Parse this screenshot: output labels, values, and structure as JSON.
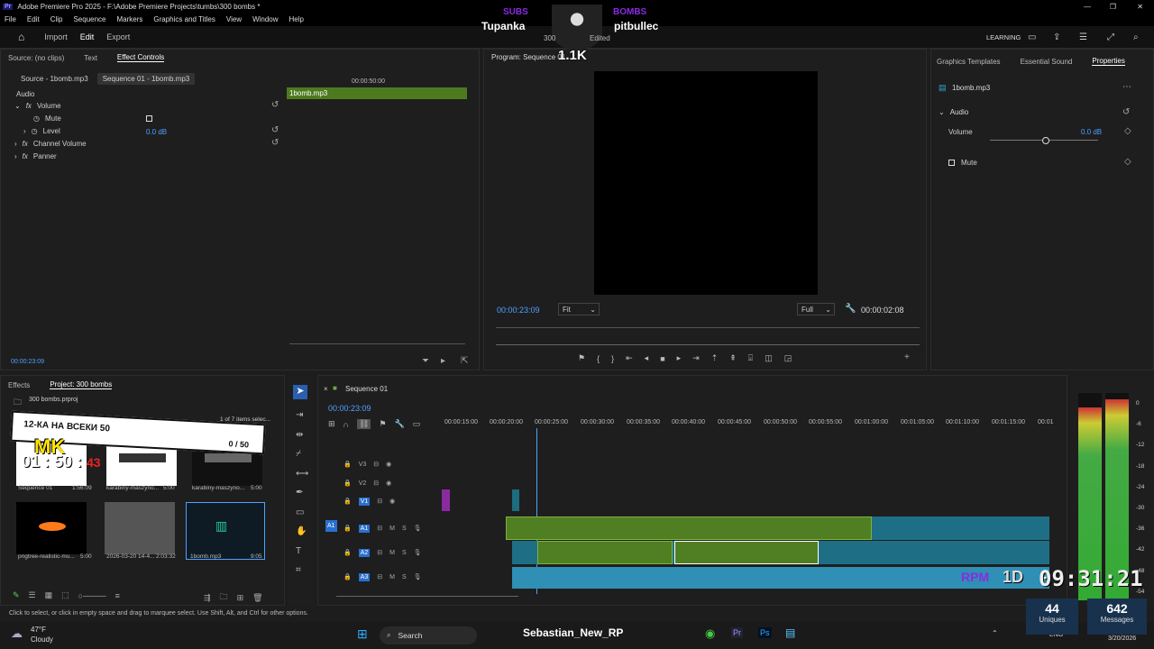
{
  "app": {
    "title": "Adobe Premiere Pro 2025 - F:\\Adobe Premiere Projects\\tumbs\\300 bombs *",
    "logo": "Pr"
  },
  "menu": [
    "File",
    "Edit",
    "Clip",
    "Sequence",
    "Markers",
    "Graphics and Titles",
    "View",
    "Window",
    "Help"
  ],
  "toolbar": {
    "import": "Import",
    "edit": "Edit",
    "export": "Export",
    "learning": "LEARNING"
  },
  "overlay": {
    "subs_label": "SUBS",
    "subs_name": "Tupanka",
    "bombs_label": "BOMBS",
    "bombs_name": "pitbullec",
    "count": "1.1K",
    "edited": "Edited",
    "num300": "300",
    "counter_title": "12-КА НА ВСЕКИ 50",
    "counter_value": "0 / 50",
    "mk": "MK",
    "timer_a": "01 : 50 :",
    "timer_b": "43",
    "rpm": "RPM",
    "days": "1D",
    "clock": "09:31:21",
    "uniques_n": "44",
    "uniques": "Uniques",
    "messages_n": "642",
    "messages": "Messages"
  },
  "source_panel": {
    "tabs": [
      "Source: (no clips)",
      "Text",
      "Effect Controls"
    ],
    "sub_tabs": [
      "Source - 1bomb.mp3",
      "Sequence 01 - 1bomb.mp3"
    ],
    "timecode_ruler": "00:00:50:00",
    "clip": "1bomb.mp3",
    "section": "Audio",
    "volume": "Volume",
    "mute": "Mute",
    "level": "Level",
    "level_value": "0.0 dB",
    "channel_volume": "Channel Volume",
    "panner": "Panner",
    "current_time": "00:00:23:09"
  },
  "program": {
    "title": "Program: Sequence 01",
    "timecode": "00:00:23:09",
    "fit": "Fit",
    "full": "Full",
    "duration": "00:00:02:08"
  },
  "properties": {
    "tabs": [
      "Graphics Templates",
      "Essential Sound",
      "Properties"
    ],
    "clip": "1bomb.mp3",
    "audio": "Audio",
    "volume": "Volume",
    "volume_value": "0.0 dB",
    "mute": "Mute"
  },
  "project": {
    "tabs": [
      "Effects",
      "Project: 300 bombs"
    ],
    "file": "300 bombs.prproj",
    "count": "1 of 7 items selec...",
    "items": [
      {
        "name": "Sequence 01",
        "dur": "1:56:09"
      },
      {
        "name": "karabiny-maszyno...",
        "dur": "5:00"
      },
      {
        "name": "karabiny-maszyno...",
        "dur": "5:00"
      },
      {
        "name": "pngtree-realistic-mu...",
        "dur": "5:00"
      },
      {
        "name": "2026-03-20 14-4...",
        "dur": "2:03:32"
      },
      {
        "name": "1bomb.mp3",
        "dur": "9:05"
      }
    ]
  },
  "timeline": {
    "tab": "Sequence 01",
    "timecode": "00:00:23:09",
    "ruler": [
      "00:00:15:00",
      "00:00:20:00",
      "00:00:25:00",
      "00:00:30:00",
      "00:00:35:00",
      "00:00:40:00",
      "00:00:45:00",
      "00:00:50:00",
      "00:00:55:00",
      "00:01:00:00",
      "00:01:05:00",
      "00:01:10:00",
      "00:01:15:00",
      "00:01"
    ],
    "tracks": [
      "V3",
      "V2",
      "V1",
      "A1",
      "A2",
      "A3"
    ],
    "src_patch": [
      "V1",
      "A1"
    ]
  },
  "meter": {
    "scale": [
      "0",
      "-6",
      "-12",
      "-18",
      "-24",
      "-30",
      "-36",
      "-42",
      "-48",
      "-54"
    ],
    "left_level": 0.93,
    "right_level": 0.97
  },
  "status": "Click to select, or click in empty space and drag to marquee select. Use Shift, Alt, and Ctrl for other options.",
  "taskbar": {
    "weather_temp": "47°F",
    "weather_desc": "Cloudy",
    "search": "Search",
    "user": "Sebastian_New_RP",
    "lang": "ENG",
    "date": "3/20/2026"
  },
  "colors": {
    "accent": "#4ea1ff",
    "clip_green": "#4f7f22",
    "clip_blue": "#2a7e96",
    "overlay_purple": "#8a2be2"
  }
}
